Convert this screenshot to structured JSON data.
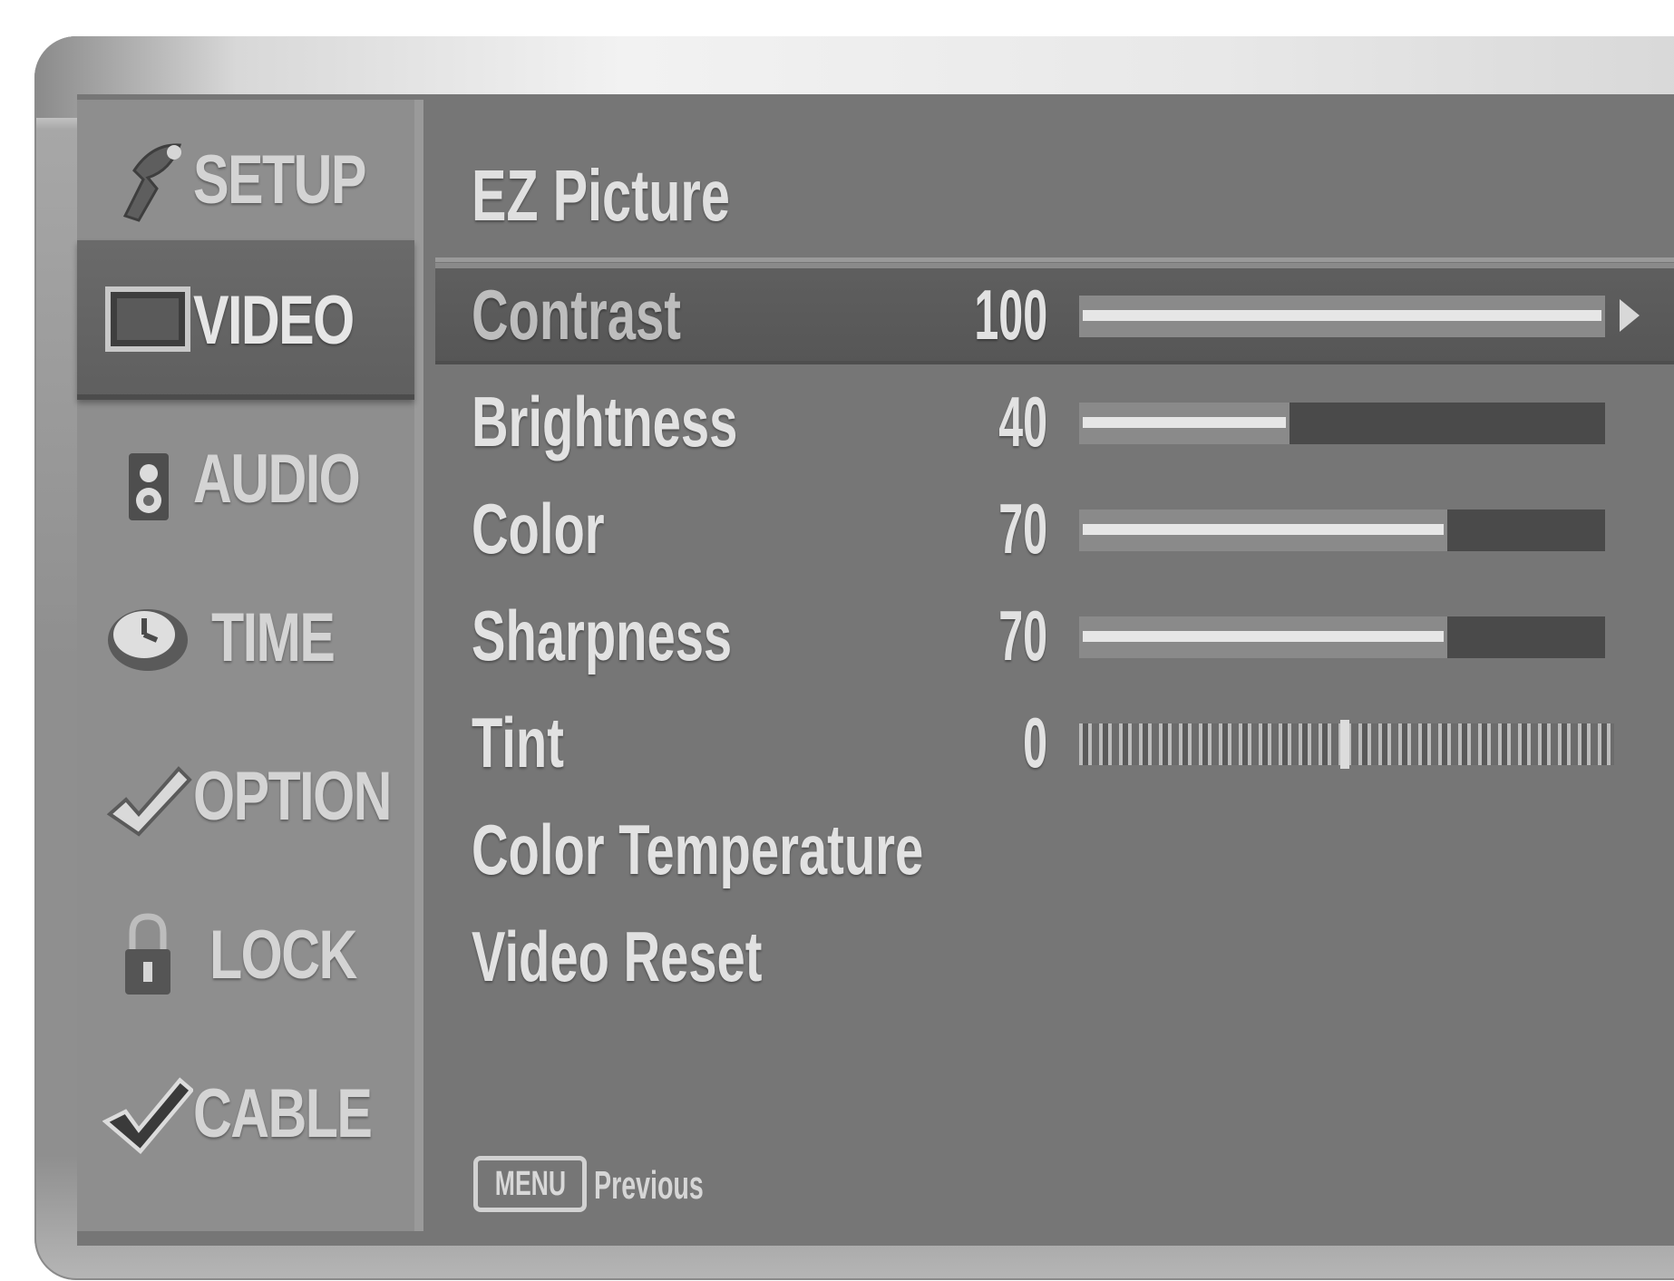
{
  "sidebar": {
    "items": [
      {
        "label": "SETUP",
        "icon": "satellite-dish-icon",
        "active": false
      },
      {
        "label": "VIDEO",
        "icon": "monitor-icon",
        "active": true
      },
      {
        "label": "AUDIO",
        "icon": "speaker-icon",
        "active": false
      },
      {
        "label": "TIME",
        "icon": "clock-icon",
        "active": false
      },
      {
        "label": "OPTION",
        "icon": "checkmark-tool-icon",
        "active": false
      },
      {
        "label": "LOCK",
        "icon": "padlock-icon",
        "active": false
      },
      {
        "label": "CABLE",
        "icon": "check-icon",
        "active": false
      }
    ]
  },
  "panel": {
    "title": "EZ Picture",
    "rows": [
      {
        "label": "Contrast",
        "value": "100",
        "level": 1.0,
        "selected": true
      },
      {
        "label": "Brightness",
        "value": "40",
        "level": 0.4
      },
      {
        "label": "Color",
        "value": "70",
        "level": 0.7
      },
      {
        "label": "Sharpness",
        "value": "70",
        "level": 0.7
      },
      {
        "label": "Tint",
        "value": "0",
        "type": "scale"
      },
      {
        "label": "Color Temperature"
      },
      {
        "label": "Video Reset"
      }
    ]
  },
  "footer": {
    "key": "MENU",
    "text": "Previous"
  },
  "colors": {
    "screen": "#767676",
    "sidebar": "#8e8e8e",
    "selected": "#5f5f5f",
    "text": "#e2e2e2"
  }
}
